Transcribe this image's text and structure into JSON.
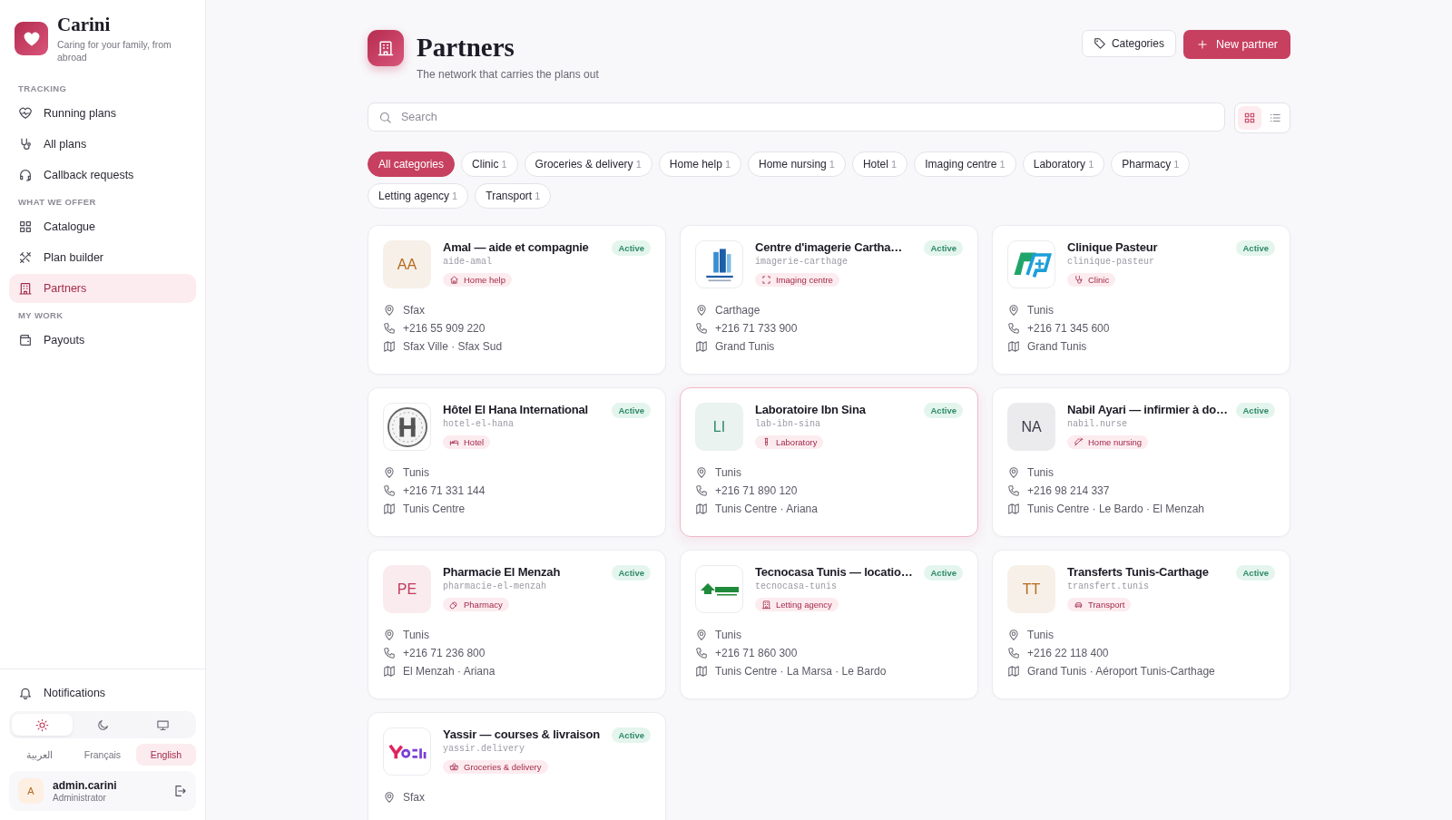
{
  "brand": {
    "name": "Carini",
    "tagline": "Caring for your family, from abroad"
  },
  "nav": [
    {
      "heading": "TRACKING",
      "items": [
        {
          "label": "Running plans",
          "selected": false
        },
        {
          "label": "All plans",
          "selected": false
        },
        {
          "label": "Callback requests",
          "selected": false
        }
      ]
    },
    {
      "heading": "WHAT WE OFFER",
      "items": [
        {
          "label": "Catalogue",
          "selected": false
        },
        {
          "label": "Plan builder",
          "selected": false
        },
        {
          "label": "Partners",
          "selected": true
        }
      ]
    },
    {
      "heading": "MY WORK",
      "items": [
        {
          "label": "Payouts",
          "selected": false
        }
      ]
    }
  ],
  "notifications": "Notifications",
  "themes": [
    {
      "kind": "light",
      "selected": true
    },
    {
      "kind": "dark",
      "selected": false
    },
    {
      "kind": "system",
      "selected": false
    }
  ],
  "languages": [
    {
      "label": "العربية",
      "selected": false
    },
    {
      "label": "Français",
      "selected": false
    },
    {
      "label": "English",
      "selected": true
    }
  ],
  "user": {
    "initial": "A",
    "name": "admin.carini",
    "role": "Administrator"
  },
  "page": {
    "title": "Partners",
    "subtitle": "The network that carries the plans out"
  },
  "actions": {
    "categories": "Categories",
    "new": "New partner"
  },
  "search": {
    "placeholder": "Search"
  },
  "views": [
    {
      "kind": "grid",
      "selected": true
    },
    {
      "kind": "list",
      "selected": false
    }
  ],
  "filters": [
    {
      "label": "All categories",
      "selected": true
    },
    {
      "label": "Clinic",
      "count": "1",
      "selected": false
    },
    {
      "label": "Groceries & delivery",
      "count": "1",
      "selected": false
    },
    {
      "label": "Home help",
      "count": "1",
      "selected": false
    },
    {
      "label": "Home nursing",
      "count": "1",
      "selected": false
    },
    {
      "label": "Hotel",
      "count": "1",
      "selected": false
    },
    {
      "label": "Imaging centre",
      "count": "1",
      "selected": false
    },
    {
      "label": "Laboratory",
      "count": "1",
      "selected": false
    },
    {
      "label": "Pharmacy",
      "count": "1",
      "selected": false
    },
    {
      "label": "Letting agency",
      "count": "1",
      "selected": false
    },
    {
      "label": "Transport",
      "count": "1",
      "selected": false
    }
  ],
  "partners": [
    {
      "name": "Amal — aide et compagnie",
      "handle": "aide-amal",
      "status": "Active",
      "category": "Home help",
      "avatar": {
        "kind": "initials",
        "text": "AA",
        "color": "#b46a1e"
      },
      "city": "Sfax",
      "phone": "+216 55 909 220",
      "areas": "Sfax Ville · Sfax Sud",
      "selected": false
    },
    {
      "name": "Centre d'imagerie Cartha…",
      "handle": "imagerie-carthage",
      "status": "Active",
      "category": "Imaging centre",
      "avatar": {
        "kind": "logo"
      },
      "city": "Carthage",
      "phone": "+216 71 733 900",
      "areas": "Grand Tunis",
      "selected": false
    },
    {
      "name": "Clinique Pasteur",
      "handle": "clinique-pasteur",
      "status": "Active",
      "category": "Clinic",
      "avatar": {
        "kind": "logo"
      },
      "city": "Tunis",
      "phone": "+216 71 345 600",
      "areas": "Grand Tunis",
      "selected": false
    },
    {
      "name": "Hôtel El Hana International",
      "handle": "hotel-el-hana",
      "status": "Active",
      "category": "Hotel",
      "avatar": {
        "kind": "logo"
      },
      "city": "Tunis",
      "phone": "+216 71 331 144",
      "areas": "Tunis Centre",
      "selected": false
    },
    {
      "name": "Laboratoire Ibn Sina",
      "handle": "lab-ibn-sina",
      "status": "Active",
      "category": "Laboratory",
      "avatar": {
        "kind": "initials",
        "text": "LI",
        "color": "#2f8a6a"
      },
      "city": "Tunis",
      "phone": "+216 71 890 120",
      "areas": "Tunis Centre · Ariana",
      "selected": true
    },
    {
      "name": "Nabil Ayari — infirmier à do…",
      "handle": "nabil.nurse",
      "status": "Active",
      "category": "Home nursing",
      "avatar": {
        "kind": "initials",
        "text": "NA",
        "color": "#3c3b4a"
      },
      "city": "Tunis",
      "phone": "+216 98 214 337",
      "areas": "Tunis Centre · Le Bardo · El Menzah",
      "selected": false
    },
    {
      "name": "Pharmacie El Menzah",
      "handle": "pharmacie-el-menzah",
      "status": "Active",
      "category": "Pharmacy",
      "avatar": {
        "kind": "initials",
        "text": "PE",
        "color": "#c0395a"
      },
      "city": "Tunis",
      "phone": "+216 71 236 800",
      "areas": "El Menzah · Ariana",
      "selected": false
    },
    {
      "name": "Tecnocasa Tunis — locatio…",
      "handle": "tecnocasa-tunis",
      "status": "Active",
      "category": "Letting agency",
      "avatar": {
        "kind": "logo"
      },
      "city": "Tunis",
      "phone": "+216 71 860 300",
      "areas": "Tunis Centre · La Marsa · Le Bardo",
      "selected": false
    },
    {
      "name": "Transferts Tunis-Carthage",
      "handle": "transfert.tunis",
      "status": "Active",
      "category": "Transport",
      "avatar": {
        "kind": "initials",
        "text": "TT",
        "color": "#b46a1e"
      },
      "city": "Tunis",
      "phone": "+216 22 118 400",
      "areas": "Grand Tunis · Aéroport Tunis-Carthage",
      "selected": false
    },
    {
      "name": "Yassir — courses & livraison",
      "handle": "yassir.delivery",
      "status": "Active",
      "category": "Groceries & delivery",
      "avatar": {
        "kind": "logo"
      },
      "city": "Sfax",
      "selected": false
    }
  ]
}
